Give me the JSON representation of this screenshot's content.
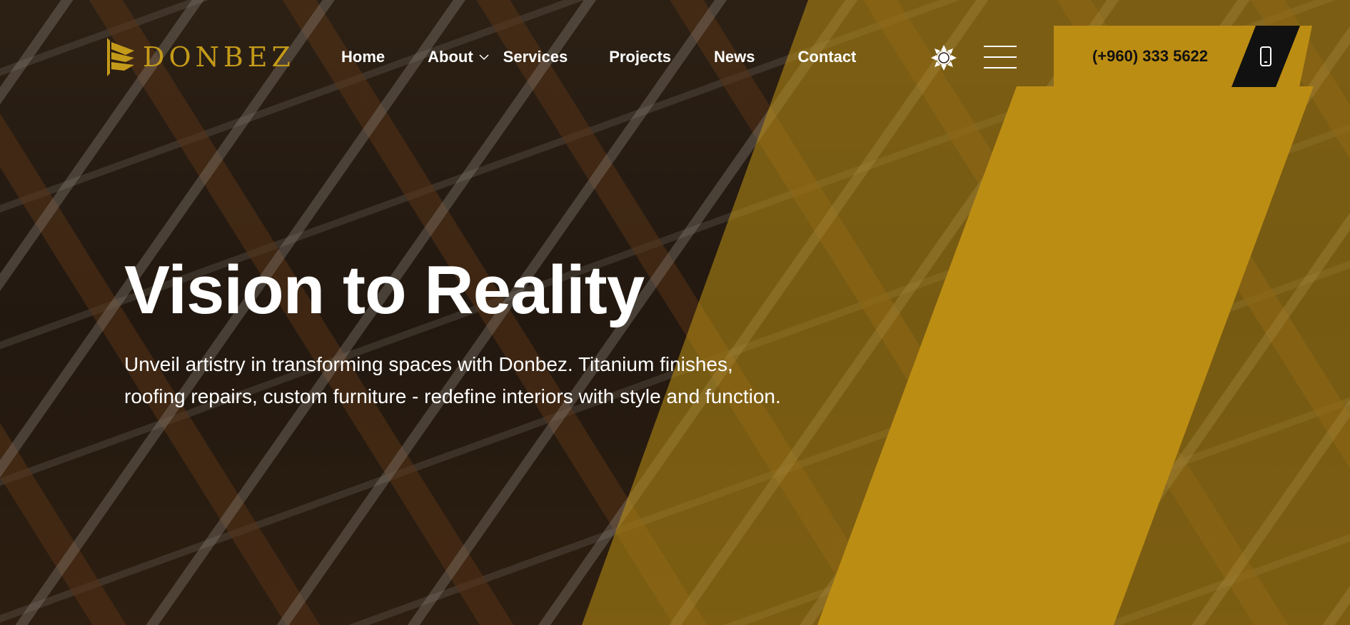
{
  "brand": {
    "name": "DONBEZ",
    "color": "#c49a1a",
    "logo_icon": "layered-chevron-logo-icon"
  },
  "nav": {
    "items": [
      {
        "label": "Home"
      },
      {
        "label": "About",
        "has_dropdown": true
      },
      {
        "label": "Services"
      },
      {
        "label": "Projects"
      },
      {
        "label": "News"
      },
      {
        "label": "Contact"
      }
    ]
  },
  "header_actions": {
    "theme_icon": "sun-icon",
    "menu_icon": "hamburger-menu-icon",
    "phone": "(+960) 333 5622",
    "phone_icon": "mobile-phone-icon"
  },
  "hero": {
    "title": "Vision to Reality",
    "description": "Unveil artistry in transforming spaces with Donbez. Titanium finishes, roofing repairs, custom furniture - redefine interiors with style and function."
  },
  "colors": {
    "accent": "#bc8d13",
    "dark": "#111111",
    "text": "#ffffff"
  }
}
